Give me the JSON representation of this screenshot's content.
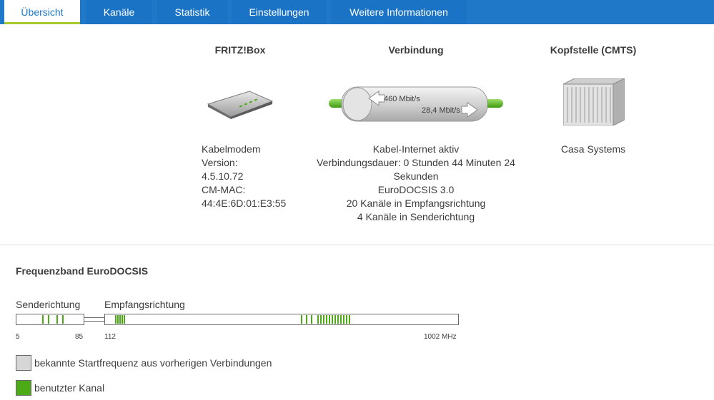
{
  "tabs": [
    {
      "label": "Übersicht",
      "active": true
    },
    {
      "label": "Kanäle",
      "active": false
    },
    {
      "label": "Statistik",
      "active": false
    },
    {
      "label": "Einstellungen",
      "active": false
    },
    {
      "label": "Weitere Informationen",
      "active": false
    }
  ],
  "overview": {
    "fritzbox": {
      "title": "FRITZ!Box",
      "lines": [
        "Kabelmodem",
        "Version:",
        "4.5.10.72",
        "CM-MAC:",
        "44:4E:6D:01:E3:55"
      ]
    },
    "connection": {
      "title": "Verbindung",
      "downstream_speed": "460 Mbit/s",
      "upstream_speed": "28,4 Mbit/s",
      "lines": [
        "Kabel-Internet aktiv",
        "Verbindungsdauer: 0 Stunden 44 Minuten 24",
        "Sekunden",
        "EuroDOCSIS 3.0",
        "20 Kanäle in Empfangsrichtung",
        "4 Kanäle in Senderichtung"
      ]
    },
    "cmts": {
      "title": "Kopfstelle (CMTS)",
      "lines": [
        "Casa Systems"
      ]
    }
  },
  "frequency_band": {
    "title": "Frequenzband EuroDOCSIS",
    "send_label": "Senderichtung",
    "receive_label": "Empfangsrichtung",
    "ticks": {
      "t5": "5",
      "t85": "85",
      "t112": "112",
      "t1002": "1002 MHz"
    },
    "send_channels_count": 4,
    "receive_channels_count": 20,
    "channel_color": "#4caa17",
    "known_color": "#d6d6d6"
  },
  "legend": {
    "known": "bekannte Startfrequenz aus vorherigen Verbindungen",
    "used": "benutzter Kanal"
  },
  "colors": {
    "tab_blue": "#1f79c8",
    "active_underline": "#a5c92a"
  }
}
